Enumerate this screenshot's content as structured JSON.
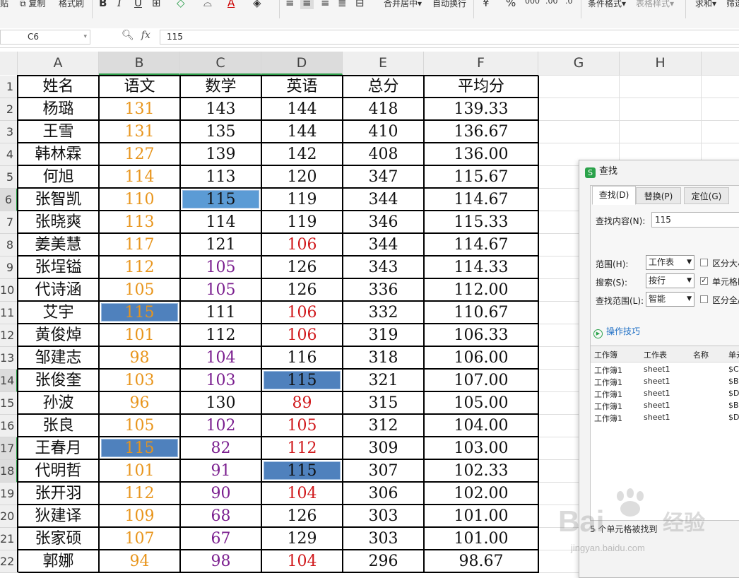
{
  "toolbar": {
    "paste": "贴",
    "copy": "复制",
    "format_painter": "格式刷",
    "merge_center": "合并居中",
    "wrap_text": "自动换行",
    "currency": "¥",
    "percent": "%",
    "conditional_format": "条件格式",
    "table_style": "表格样式",
    "sum": "求和",
    "filter": "筛选",
    "bold": "B",
    "italic": "I",
    "underline": "U",
    "font_color": "A"
  },
  "formula_bar": {
    "cell_ref": "C6",
    "fx_label": "fx",
    "value": "115"
  },
  "columns": [
    "A",
    "B",
    "C",
    "D",
    "E",
    "F",
    "G",
    "H"
  ],
  "row_numbers": [
    "1",
    "2",
    "3",
    "4",
    "5",
    "6",
    "7",
    "8",
    "9",
    "10",
    "11",
    "12",
    "13",
    "14",
    "15",
    "16",
    "17",
    "18",
    "19",
    "20",
    "21",
    "22"
  ],
  "table": {
    "headers": [
      "姓名",
      "语文",
      "数学",
      "英语",
      "总分",
      "平均分"
    ],
    "rows": [
      [
        "杨璐",
        "131",
        "143",
        "144",
        "418",
        "139.33"
      ],
      [
        "王雪",
        "131",
        "135",
        "144",
        "410",
        "136.67"
      ],
      [
        "韩林霖",
        "127",
        "139",
        "142",
        "408",
        "136.00"
      ],
      [
        "何旭",
        "114",
        "113",
        "120",
        "347",
        "115.67"
      ],
      [
        "张智凯",
        "110",
        "115",
        "119",
        "344",
        "114.67"
      ],
      [
        "张晓爽",
        "113",
        "114",
        "119",
        "346",
        "115.33"
      ],
      [
        "姜美慧",
        "117",
        "121",
        "106",
        "344",
        "114.67"
      ],
      [
        "张埕镒",
        "112",
        "105",
        "126",
        "343",
        "114.33"
      ],
      [
        "代诗涵",
        "105",
        "105",
        "126",
        "336",
        "112.00"
      ],
      [
        "艾宇",
        "115",
        "111",
        "106",
        "332",
        "110.67"
      ],
      [
        "黄俊焯",
        "101",
        "112",
        "106",
        "319",
        "106.33"
      ],
      [
        "邹建志",
        "98",
        "104",
        "116",
        "318",
        "106.00"
      ],
      [
        "张俊奎",
        "103",
        "103",
        "115",
        "321",
        "107.00"
      ],
      [
        "孙波",
        "96",
        "130",
        "89",
        "315",
        "105.00"
      ],
      [
        "张良",
        "105",
        "102",
        "105",
        "312",
        "104.00"
      ],
      [
        "王春月",
        "115",
        "82",
        "112",
        "309",
        "103.00"
      ],
      [
        "代明哲",
        "101",
        "91",
        "115",
        "307",
        "102.33"
      ],
      [
        "张开羽",
        "112",
        "90",
        "104",
        "306",
        "102.00"
      ],
      [
        "狄建译",
        "109",
        "68",
        "126",
        "303",
        "101.00"
      ],
      [
        "张家硕",
        "107",
        "67",
        "129",
        "303",
        "101.00"
      ],
      [
        "郭娜",
        "94",
        "98",
        "104",
        "296",
        "98.67"
      ]
    ],
    "colors": {
      "default": "#111111",
      "chinese": "#e8951c",
      "math_low": "#7b1f8f",
      "english_low": "#d0191c",
      "highlight": "#4f81bd",
      "active_highlight": "#5b9bd5"
    }
  },
  "dialog": {
    "title": "查找",
    "tabs": [
      "查找(D)",
      "替换(P)",
      "定位(G)"
    ],
    "find_label": "查找内容(N):",
    "find_value": "115",
    "range_label": "范围(H):",
    "range_value": "工作表",
    "search_label": "搜索(S):",
    "search_value": "按行",
    "lookin_label": "查找范围(L):",
    "lookin_value": "智能",
    "opt_case": "区分大小",
    "opt_cell": "单元格匹",
    "opt_width": "区分全/",
    "opt_cell_checked": true,
    "tips": "操作技巧",
    "result_headers": [
      "工作簿",
      "工作表",
      "名称",
      "单元"
    ],
    "results": [
      [
        "工作簿1",
        "sheet1",
        "",
        "$C"
      ],
      [
        "工作簿1",
        "sheet1",
        "",
        "$B"
      ],
      [
        "工作簿1",
        "sheet1",
        "",
        "$D"
      ],
      [
        "工作簿1",
        "sheet1",
        "",
        "$B"
      ],
      [
        "工作簿1",
        "sheet1",
        "",
        "$D"
      ]
    ],
    "footer": "5 个单元格被找到"
  },
  "watermark": {
    "brand": "Bai",
    "brand2": "经验",
    "url": "jingyan.baidu.com"
  }
}
